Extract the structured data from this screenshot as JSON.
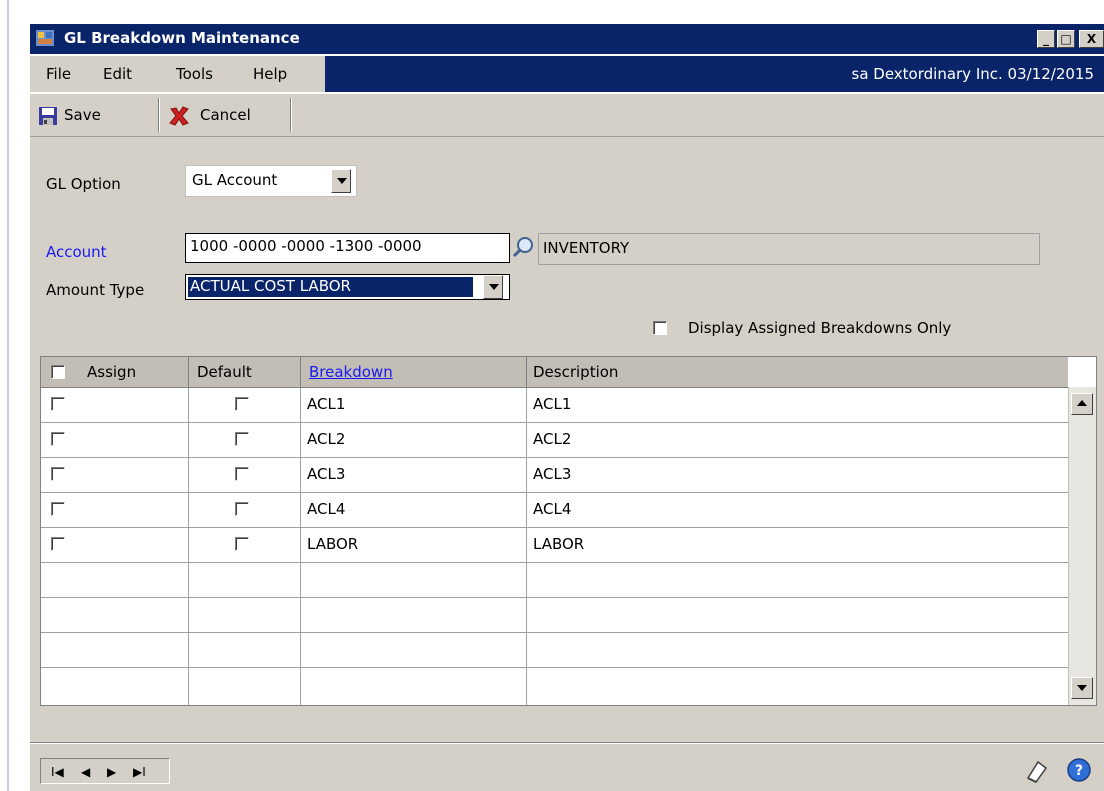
{
  "window": {
    "title": "GL Breakdown Maintenance",
    "min_label": "_",
    "max_label": "□",
    "close_label": "X"
  },
  "menu": {
    "items": [
      "File",
      "Edit",
      "Tools",
      "Help"
    ],
    "status": "sa  Dextordinary Inc.  03/12/2015"
  },
  "toolbar": {
    "save_label": "Save",
    "cancel_label": "Cancel"
  },
  "form": {
    "gl_option_label": "GL Option",
    "gl_option_value": "GL Account",
    "account_label": "Account",
    "account_value": "1000 -0000 -0000 -1300 -0000",
    "account_description": "INVENTORY",
    "amount_type_label": "Amount Type",
    "amount_type_value": "ACTUAL COST LABOR",
    "display_assigned_label": "Display Assigned Breakdowns Only"
  },
  "grid": {
    "columns": [
      "Assign",
      "Default",
      "Breakdown",
      "Description"
    ],
    "rows": [
      {
        "breakdown": "ACL1",
        "description": "ACL1"
      },
      {
        "breakdown": "ACL2",
        "description": "ACL2"
      },
      {
        "breakdown": "ACL3",
        "description": "ACL3"
      },
      {
        "breakdown": "ACL4",
        "description": "ACL4"
      },
      {
        "breakdown": "LABOR",
        "description": "LABOR"
      }
    ]
  },
  "nav": {
    "first": "I◀",
    "prev": "◀",
    "next": "▶",
    "last": "▶I"
  },
  "colors": {
    "title_bg": "#0a246a",
    "highlight_oval": "#e0262a",
    "selected_bg": "#0a246a"
  }
}
